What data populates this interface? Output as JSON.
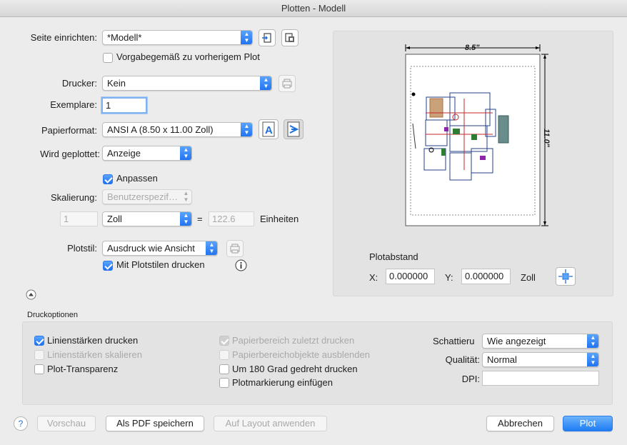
{
  "window": {
    "title": "Plotten - Modell"
  },
  "page_setup": {
    "label": "Seite einrichten:",
    "value": "*Modell*",
    "checkbox_label": "Vorgabegemäß zu vorherigem Plot",
    "checkbox_checked": false
  },
  "printer": {
    "label": "Drucker:",
    "value": "Kein"
  },
  "copies": {
    "label": "Exemplare:",
    "value": "1"
  },
  "paper": {
    "label": "Papierformat:",
    "value": "ANSI A (8.50 x 11.00 Zoll)"
  },
  "plot_area": {
    "label": "Wird geplottet:",
    "value": "Anzeige"
  },
  "fit": {
    "label": "Anpassen",
    "checked": true
  },
  "scale": {
    "label": "Skalierung:",
    "value": "Benutzerspezif…",
    "left_value": "1",
    "unit": "Zoll",
    "equals": "=",
    "right_value": "122.6",
    "units_label": "Einheiten"
  },
  "plot_style": {
    "label": "Plotstil:",
    "value": "Ausdruck wie Ansicht",
    "checkbox_label": "Mit Plotstilen drucken",
    "checkbox_checked": true
  },
  "preview": {
    "width_label": "8.5\"",
    "height_label": "11.0\""
  },
  "offset": {
    "title": "Plotabstand",
    "x_label": "X:",
    "x_value": "0.000000",
    "y_label": "Y:",
    "y_value": "0.000000",
    "unit": "Zoll"
  },
  "print_options": {
    "title": "Druckoptionen",
    "col1": [
      {
        "label": "Linienstärken drucken",
        "checked": true,
        "disabled": false
      },
      {
        "label": "Linienstärken skalieren",
        "checked": false,
        "disabled": true
      },
      {
        "label": "Plot-Transparenz",
        "checked": false,
        "disabled": false
      }
    ],
    "col2": [
      {
        "label": "Papierbereich zuletzt drucken",
        "checked": true,
        "disabled": true
      },
      {
        "label": "Papierbereichobjekte ausblenden",
        "checked": false,
        "disabled": true
      },
      {
        "label": "Um 180 Grad gedreht drucken",
        "checked": false,
        "disabled": false
      },
      {
        "label": "Plotmarkierung einfügen",
        "checked": false,
        "disabled": false
      }
    ],
    "shading_label": "Schattieru",
    "shading_value": "Wie angezeigt",
    "quality_label": "Qualität:",
    "quality_value": "Normal",
    "dpi_label": "DPI:",
    "dpi_value": ""
  },
  "footer": {
    "help": "?",
    "preview": "Vorschau",
    "save_pdf": "Als PDF speichern",
    "apply_layout": "Auf Layout anwenden",
    "cancel": "Abbrechen",
    "plot": "Plot"
  }
}
